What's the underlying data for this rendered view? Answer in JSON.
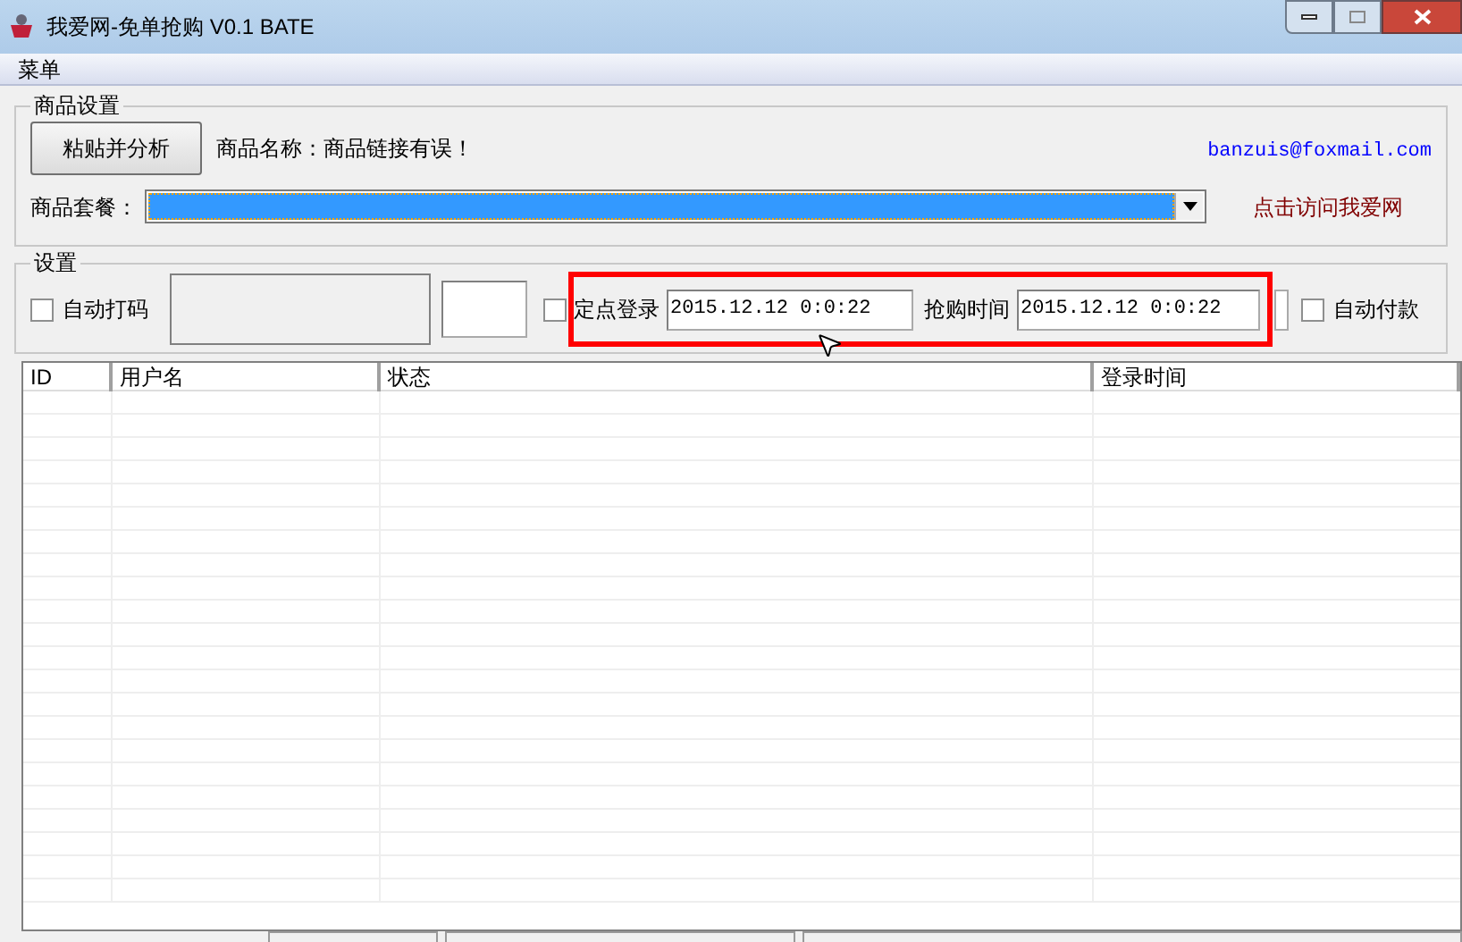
{
  "window": {
    "title": "我爱网-免单抢购 V0.1 BATE"
  },
  "menu": [
    "菜单"
  ],
  "product_group": {
    "title": "商品设置",
    "analyze_button": "粘贴并分析",
    "product_name": "商品名称：商品链接有误！",
    "email": "banzuis@foxmail.com",
    "package_label": "商品套餐：",
    "visit_link": "点击访问我爱网"
  },
  "settings_group": {
    "title": "设置",
    "auto_captcha": {
      "label": "自动打码",
      "checked": false
    },
    "timed_login": {
      "label": "定点登录",
      "checked": false,
      "value": "2015.12.12 0:0:22"
    },
    "buy_time": {
      "label": "抢购时间",
      "value": "2015.12.12 0:0:22"
    },
    "auto_pay": {
      "label": "自动付款",
      "checked": false
    }
  },
  "table": {
    "columns": [
      "ID",
      "用户名",
      "状态",
      "登录时间"
    ]
  }
}
